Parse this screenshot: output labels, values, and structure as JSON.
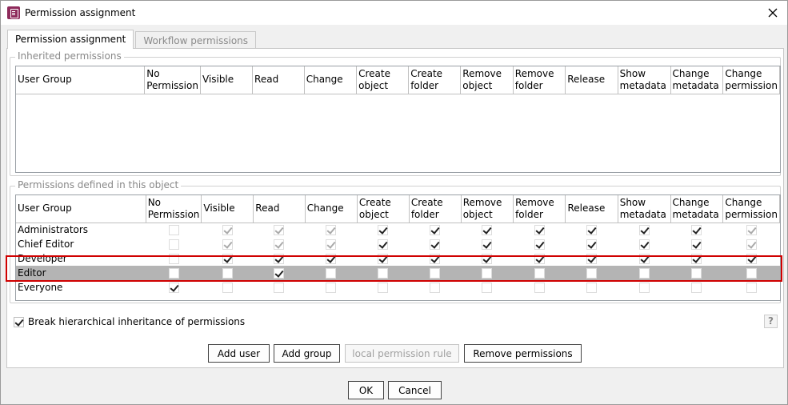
{
  "window": {
    "title": "Permission assignment"
  },
  "tabs": [
    {
      "label": "Permission assignment",
      "active": true
    },
    {
      "label": "Workflow permissions",
      "active": false
    }
  ],
  "inherited": {
    "label": "Inherited permissions",
    "rows": []
  },
  "columns": [
    "User Group",
    "No Permission",
    "Visible",
    "Read",
    "Change",
    "Create object",
    "Create folder",
    "Remove object",
    "Remove folder",
    "Release",
    "Show metadata",
    "Change metadata",
    "Change permission"
  ],
  "defined": {
    "label": "Permissions defined in this object",
    "rows": [
      {
        "name": "Administrators",
        "perms": [
          0,
          1,
          1,
          1,
          1,
          1,
          1,
          1,
          1,
          1,
          1,
          1
        ],
        "disabled": [
          1,
          1,
          1,
          1,
          0,
          0,
          0,
          0,
          0,
          0,
          0,
          1
        ],
        "selected": false
      },
      {
        "name": "Chief Editor",
        "perms": [
          0,
          1,
          1,
          1,
          1,
          1,
          1,
          1,
          1,
          1,
          1,
          1
        ],
        "disabled": [
          1,
          1,
          1,
          1,
          0,
          0,
          0,
          0,
          0,
          0,
          0,
          1
        ],
        "selected": false
      },
      {
        "name": "Developer",
        "perms": [
          0,
          1,
          1,
          1,
          1,
          1,
          1,
          1,
          1,
          1,
          1,
          1
        ],
        "disabled": [
          1,
          0,
          0,
          0,
          0,
          0,
          0,
          0,
          0,
          0,
          0,
          0
        ],
        "selected": false
      },
      {
        "name": "Editor",
        "perms": [
          0,
          0,
          1,
          0,
          0,
          0,
          0,
          0,
          0,
          0,
          0,
          0
        ],
        "disabled": [
          0,
          0,
          0,
          0,
          0,
          0,
          0,
          0,
          0,
          0,
          0,
          0
        ],
        "selected": true
      },
      {
        "name": "Everyone",
        "perms": [
          1,
          0,
          0,
          0,
          0,
          0,
          0,
          0,
          0,
          0,
          0,
          0
        ],
        "disabled": [
          0,
          1,
          1,
          1,
          1,
          1,
          1,
          1,
          1,
          1,
          1,
          1
        ],
        "selected": false
      }
    ]
  },
  "options": {
    "break_inheritance_label": "Break hierarchical inheritance of permissions",
    "break_inheritance_checked": true
  },
  "help": {
    "symbol": "?"
  },
  "actions": {
    "add_user": "Add user",
    "add_group": "Add group",
    "local_rule": "local permission rule",
    "remove_permissions": "Remove permissions"
  },
  "dialog": {
    "ok": "OK",
    "cancel": "Cancel"
  }
}
